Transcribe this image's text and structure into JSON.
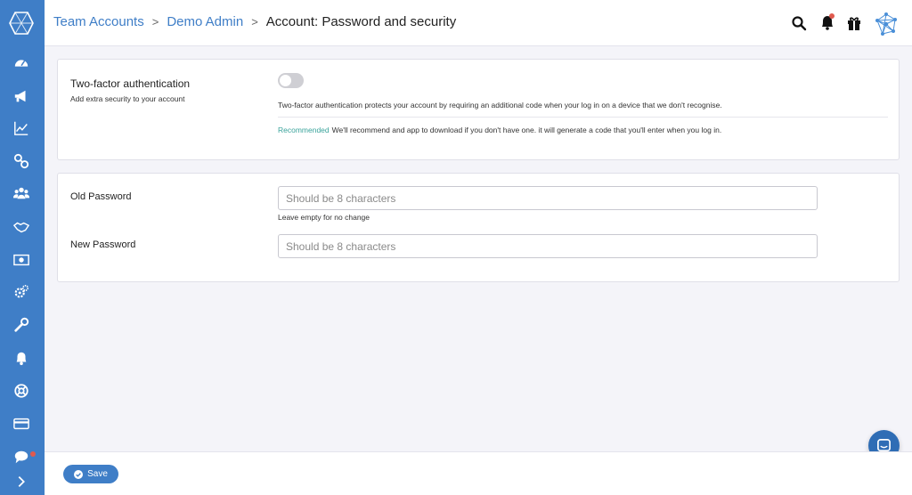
{
  "header": {
    "breadcrumbs": [
      {
        "label": "Team Accounts"
      },
      {
        "label": "Demo Admin"
      }
    ],
    "separator": ">",
    "current": "Account: Password and security",
    "icons": [
      "search-icon",
      "bell-icon",
      "gift-icon",
      "network-avatar-icon"
    ]
  },
  "sidebar": {
    "icons": [
      "dashboard-icon",
      "megaphone-icon",
      "chart-line-icon",
      "link-icon",
      "users-icon",
      "handshake-icon",
      "money-icon",
      "cogs-icon",
      "wrench-icon",
      "bell-icon",
      "lifebuoy-icon",
      "credit-card-icon",
      "chat-icon",
      "chevron-right-icon"
    ]
  },
  "two_factor": {
    "title": "Two-factor authentication",
    "subtitle": "Add extra security to your account",
    "enabled": false,
    "description": "Two-factor authentication protects your account by requiring an additional code when your log in on a device that we don't recognise.",
    "recommended_label": "Recommended",
    "recommended_text": "We'll recommend and app to download if you don't have one. it will generate a code that you'll enter when you log in."
  },
  "password": {
    "old_label": "Old Password",
    "old_placeholder": "Should be 8 characters",
    "old_hint": "Leave empty for no change",
    "new_label": "New Password",
    "new_placeholder": "Should be 8 characters"
  },
  "footer": {
    "save_label": "Save"
  },
  "colors": {
    "primary": "#3f7ec7",
    "accent_green": "#3aa39b",
    "notification": "#e05a4f"
  }
}
